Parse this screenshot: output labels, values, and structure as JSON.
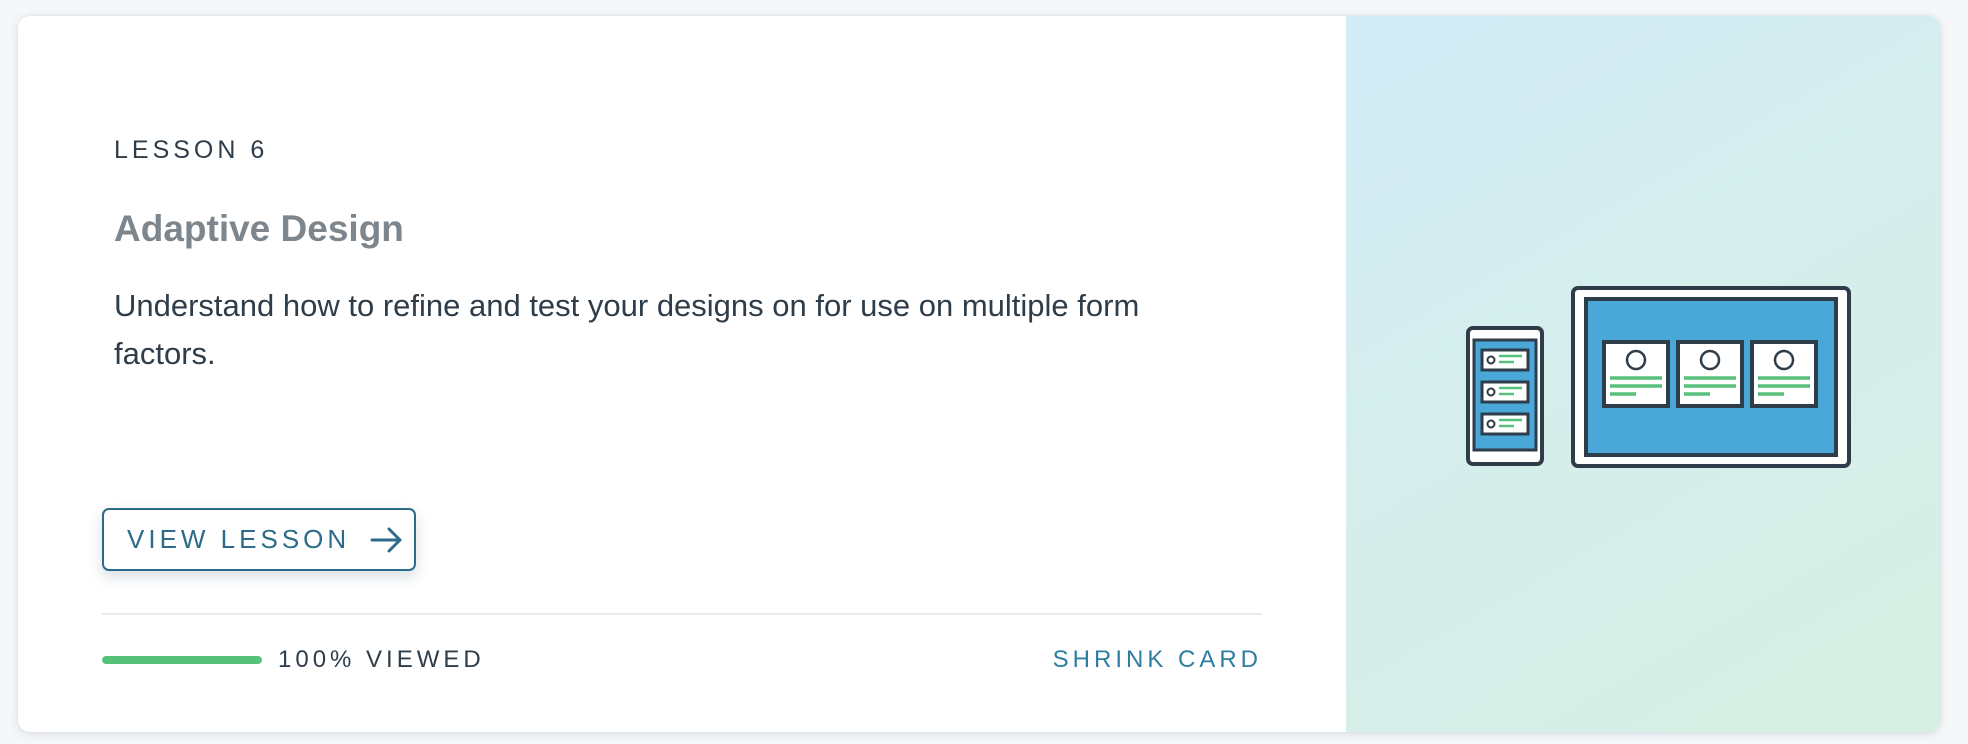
{
  "lesson": {
    "number_label": "LESSON 6",
    "title": "Adaptive Design",
    "summary": "Understand how to refine and test your designs on for use on multiple form factors."
  },
  "actions": {
    "view_lesson_label": "VIEW LESSON",
    "view_lesson_icon": "arrow-right-icon",
    "shrink_card_label": "SHRINK CARD"
  },
  "progress": {
    "percent": 100,
    "label": "100% VIEWED"
  },
  "illustration": {
    "name": "adaptive-devices-illustration",
    "colors": {
      "device_outline": "#2e3d49",
      "screen_fill": "#4aa8d8",
      "line_accent": "#57c17b",
      "card_fill": "#ffffff"
    }
  },
  "colors": {
    "text_primary": "#2e3d49",
    "title_gray": "#7d868c",
    "accent_blue": "#2d6b8a",
    "link_blue": "#2d7ea0",
    "progress_green": "#57c17b"
  }
}
